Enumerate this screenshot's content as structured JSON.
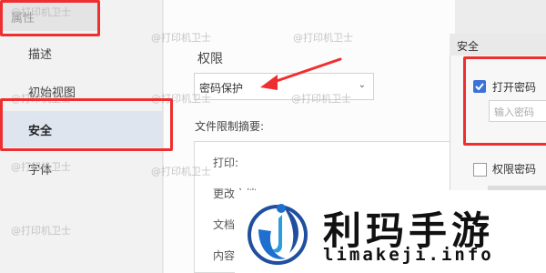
{
  "window": {
    "title": "属性"
  },
  "nav": {
    "items": [
      {
        "label": "描述"
      },
      {
        "label": "初始视图"
      },
      {
        "label": "安全"
      },
      {
        "label": "字体"
      }
    ]
  },
  "permissions": {
    "section_label": "权限",
    "select_value": "密码保护",
    "summary_label": "文件限制摘要:",
    "summary_items": [
      "打印:",
      "更改文档",
      "文档",
      "内容"
    ]
  },
  "security_dialog": {
    "title": "安全",
    "open_password_label": "打开密码",
    "open_password_checked": true,
    "password_placeholder": "输入密码",
    "perm_password_label": "权限密码",
    "perm_password_checked": false
  },
  "watermark": {
    "text": "@打印机卫士"
  },
  "banner": {
    "brand": "利玛手游",
    "site": "limakeji.info"
  },
  "colors": {
    "annotation": "#ef2f2f",
    "accent": "#3a72d8",
    "nav_selected": "#dfe5ef"
  }
}
